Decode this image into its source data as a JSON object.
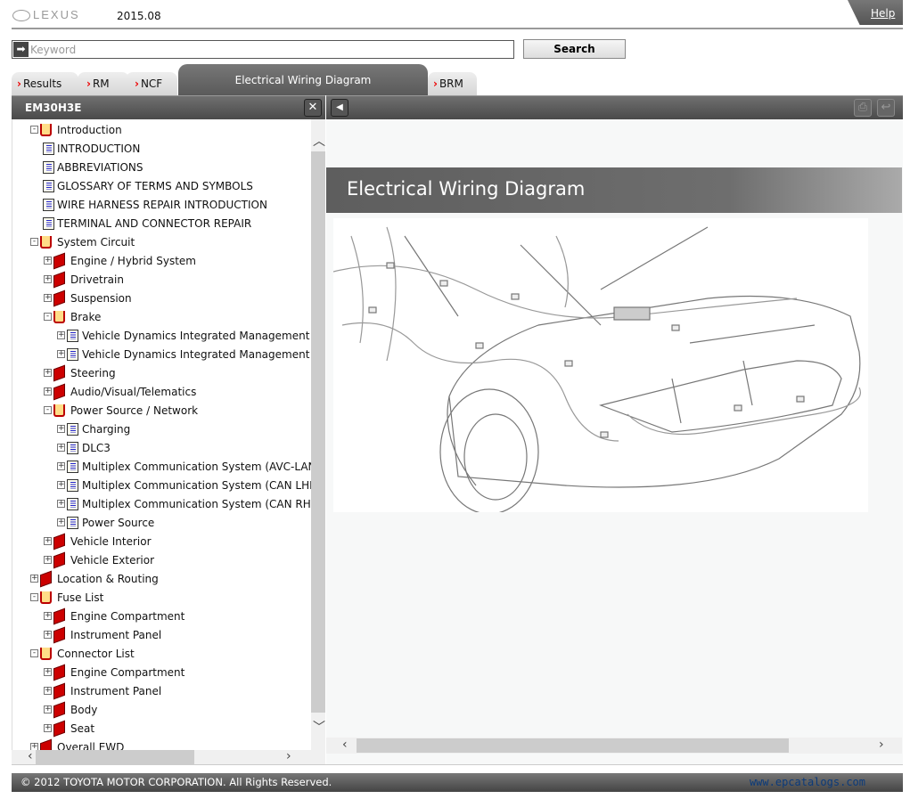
{
  "header": {
    "logo": "LEXUS",
    "version": "2015.08",
    "help": "Help"
  },
  "search": {
    "placeholder": "Keyword",
    "value": "",
    "button": "Search"
  },
  "tabs": [
    {
      "label": "Results"
    },
    {
      "label": "RM"
    },
    {
      "label": "NCF"
    },
    {
      "label": "Electrical Wiring Diagram",
      "active": true
    },
    {
      "label": "BRM"
    }
  ],
  "left_panel": {
    "title": "EM30H3E"
  },
  "tree": [
    {
      "label": "Introduction",
      "level": 0,
      "icon": "book-open",
      "expander": "-"
    },
    {
      "label": "INTRODUCTION",
      "level": 0.5,
      "icon": "document",
      "expander": ""
    },
    {
      "label": "ABBREVIATIONS",
      "level": 0.5,
      "icon": "document",
      "expander": ""
    },
    {
      "label": "GLOSSARY OF TERMS AND SYMBOLS",
      "level": 0.5,
      "icon": "document",
      "expander": ""
    },
    {
      "label": "WIRE HARNESS REPAIR INTRODUCTION",
      "level": 0.5,
      "icon": "document",
      "expander": ""
    },
    {
      "label": "TERMINAL AND CONNECTOR REPAIR",
      "level": 0.5,
      "icon": "document",
      "expander": ""
    },
    {
      "label": "System Circuit",
      "level": 0,
      "icon": "book-open",
      "expander": "-"
    },
    {
      "label": "Engine / Hybrid System",
      "level": 1,
      "icon": "book-closed",
      "expander": "+"
    },
    {
      "label": "Drivetrain",
      "level": 1,
      "icon": "book-closed",
      "expander": "+"
    },
    {
      "label": "Suspension",
      "level": 1,
      "icon": "book-closed",
      "expander": "+"
    },
    {
      "label": "Brake",
      "level": 1,
      "icon": "book-open",
      "expander": "-"
    },
    {
      "label": "Vehicle Dynamics Integrated Management (LHD)",
      "level": 2,
      "icon": "document",
      "expander": "+"
    },
    {
      "label": "Vehicle Dynamics Integrated Management (RHD)",
      "level": 2,
      "icon": "document",
      "expander": "+"
    },
    {
      "label": "Steering",
      "level": 1,
      "icon": "book-closed",
      "expander": "+"
    },
    {
      "label": "Audio/Visual/Telematics",
      "level": 1,
      "icon": "book-closed",
      "expander": "+"
    },
    {
      "label": "Power Source / Network",
      "level": 1,
      "icon": "book-open",
      "expander": "-"
    },
    {
      "label": "Charging",
      "level": 2,
      "icon": "document",
      "expander": "+"
    },
    {
      "label": "DLC3",
      "level": 2,
      "icon": "document",
      "expander": "+"
    },
    {
      "label": "Multiplex Communication System (AVC-LAN)",
      "level": 2,
      "icon": "document",
      "expander": "+"
    },
    {
      "label": "Multiplex Communication System (CAN LHD) (",
      "level": 2,
      "icon": "document",
      "expander": "+"
    },
    {
      "label": "Multiplex Communication System (CAN RHD) (",
      "level": 2,
      "icon": "document",
      "expander": "+"
    },
    {
      "label": "Power Source",
      "level": 2,
      "icon": "document",
      "expander": "+"
    },
    {
      "label": "Vehicle Interior",
      "level": 1,
      "icon": "book-closed",
      "expander": "+"
    },
    {
      "label": "Vehicle Exterior",
      "level": 1,
      "icon": "book-closed",
      "expander": "+"
    },
    {
      "label": "Location & Routing",
      "level": 0,
      "icon": "book-closed",
      "expander": "+"
    },
    {
      "label": "Fuse List",
      "level": 0,
      "icon": "book-open",
      "expander": "-"
    },
    {
      "label": "Engine Compartment",
      "level": 1,
      "icon": "book-closed",
      "expander": "+"
    },
    {
      "label": "Instrument Panel",
      "level": 1,
      "icon": "book-closed",
      "expander": "+"
    },
    {
      "label": "Connector List",
      "level": 0,
      "icon": "book-open",
      "expander": "-"
    },
    {
      "label": "Engine Compartment",
      "level": 1,
      "icon": "book-closed",
      "expander": "+"
    },
    {
      "label": "Instrument Panel",
      "level": 1,
      "icon": "book-closed",
      "expander": "+"
    },
    {
      "label": "Body",
      "level": 1,
      "icon": "book-closed",
      "expander": "+"
    },
    {
      "label": "Seat",
      "level": 1,
      "icon": "book-closed",
      "expander": "+"
    },
    {
      "label": "Overall EWD",
      "level": 0,
      "icon": "book-closed",
      "expander": "+"
    }
  ],
  "content": {
    "heading": "Electrical Wiring Diagram"
  },
  "footer": {
    "copyright": "© 2012 TOYOTA MOTOR CORPORATION. All Rights Reserved.",
    "watermark": "www.epcatalogs.com"
  },
  "colors": {
    "tab_chevron": "#e00000",
    "bar_dark": "#555555",
    "watermark": "#0b3a7a"
  }
}
